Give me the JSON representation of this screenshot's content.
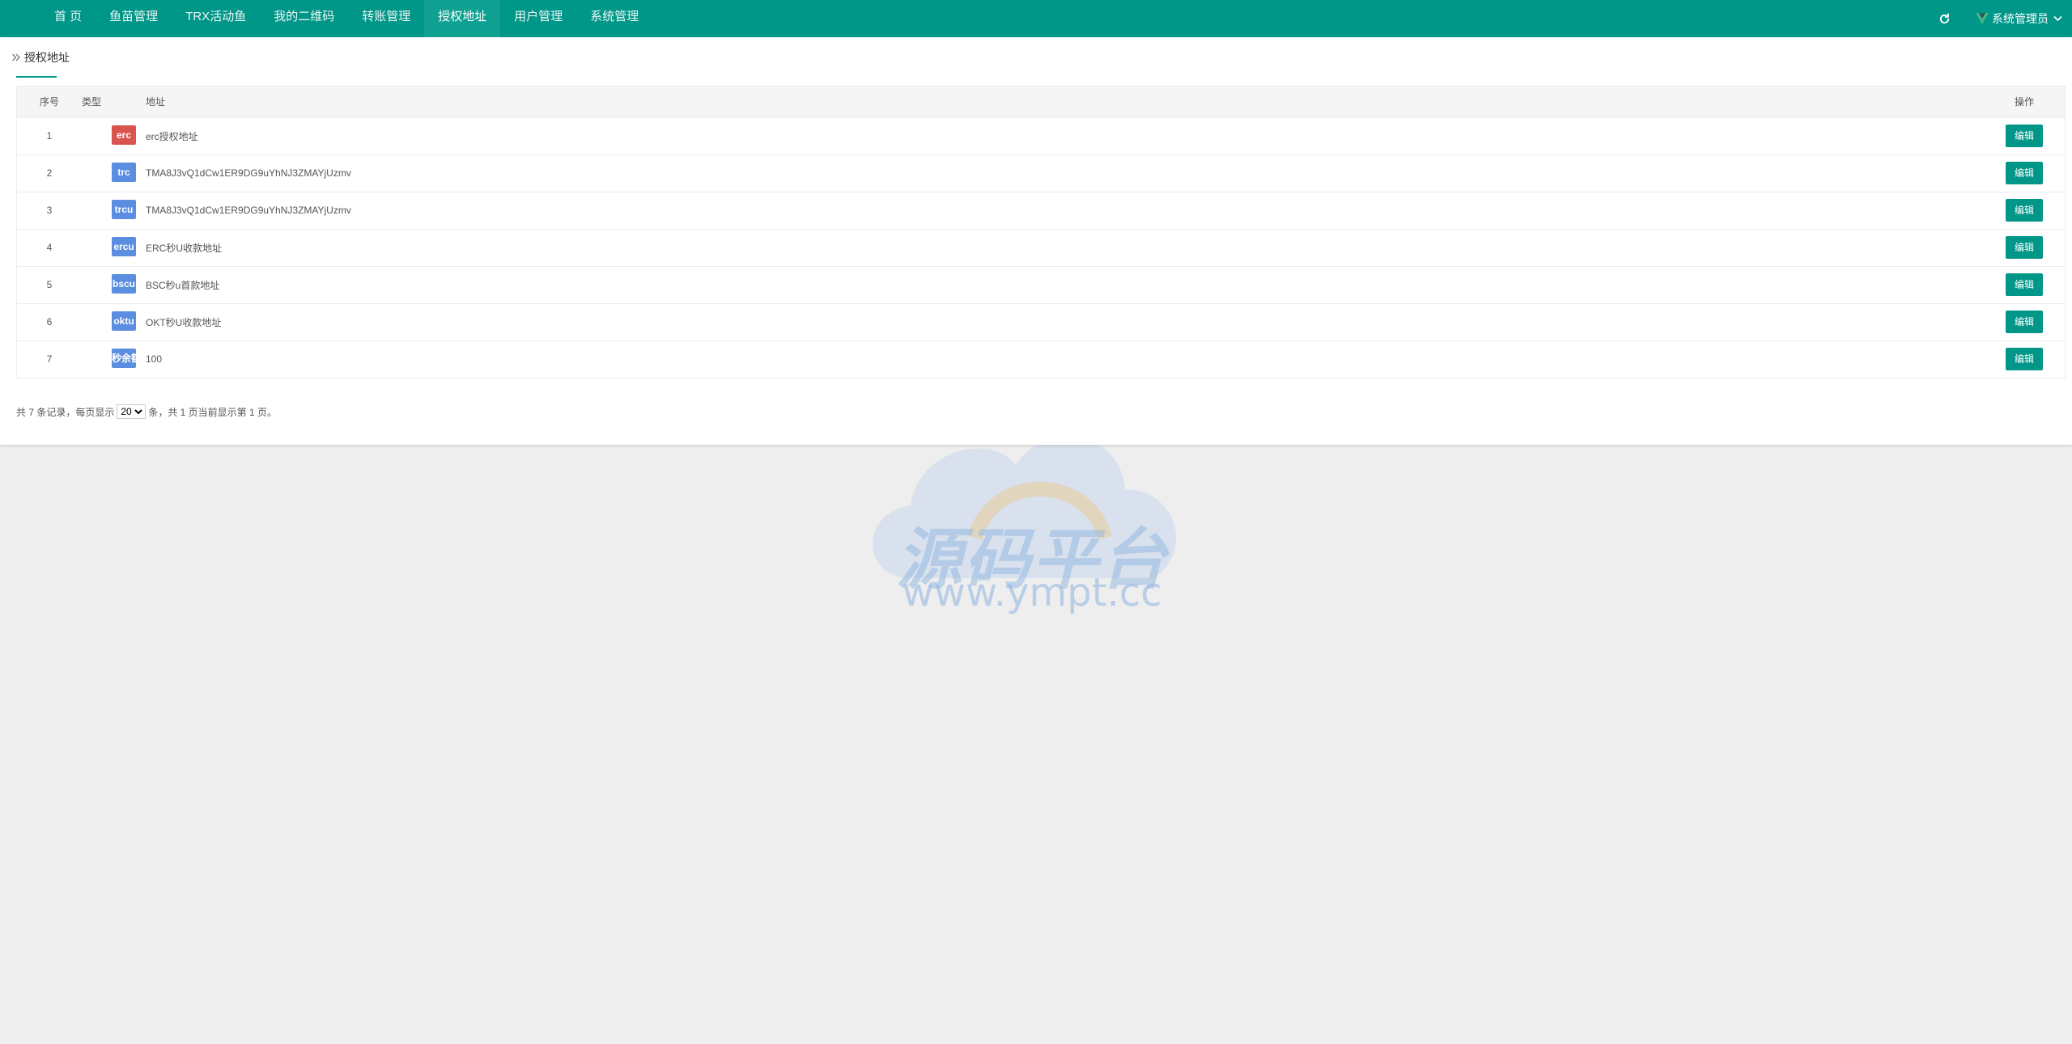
{
  "nav": {
    "items": [
      {
        "label": "首 页"
      },
      {
        "label": "鱼苗管理"
      },
      {
        "label": "TRX活动鱼"
      },
      {
        "label": "我的二维码"
      },
      {
        "label": "转账管理"
      },
      {
        "label": "授权地址",
        "active": true
      },
      {
        "label": "用户管理"
      },
      {
        "label": "系统管理"
      }
    ],
    "user_name": "系统管理员",
    "accent_color": "#009688"
  },
  "breadcrumb": {
    "title": "授权地址"
  },
  "table": {
    "headers": {
      "index": "序号",
      "type": "类型",
      "address": "地址",
      "action": "操作"
    },
    "rows": [
      {
        "index": "1",
        "type": "erc",
        "badge_color": "#d9534f",
        "address": "erc授权地址",
        "action": "编辑"
      },
      {
        "index": "2",
        "type": "trc",
        "badge_color": "#5b8de0",
        "address": "TMA8J3vQ1dCw1ER9DG9uYhNJ3ZMAYjUzmv",
        "action": "编辑"
      },
      {
        "index": "3",
        "type": "trcu",
        "badge_color": "#5b8de0",
        "address": "TMA8J3vQ1dCw1ER9DG9uYhNJ3ZMAYjUzmv",
        "action": "编辑"
      },
      {
        "index": "4",
        "type": "ercu",
        "badge_color": "#5b8de0",
        "address": "ERC秒U收款地址",
        "action": "编辑"
      },
      {
        "index": "5",
        "type": "bscu",
        "badge_color": "#5b8de0",
        "address": "BSC秒u首款地址",
        "action": "编辑"
      },
      {
        "index": "6",
        "type": "oktu",
        "badge_color": "#5b8de0",
        "address": "OKT秒U收款地址",
        "action": "编辑"
      },
      {
        "index": "7",
        "type": "秒余额",
        "badge_color": "#5b8de0",
        "address": "100",
        "action": "编辑"
      }
    ]
  },
  "pagination": {
    "prefix": "共 7 条记录，每页显示",
    "page_size": "20",
    "suffix": "条，共 1 页当前显示第 1 页。"
  },
  "watermark": {
    "cn": "源码平台",
    "url": "www.ympt.cc"
  }
}
